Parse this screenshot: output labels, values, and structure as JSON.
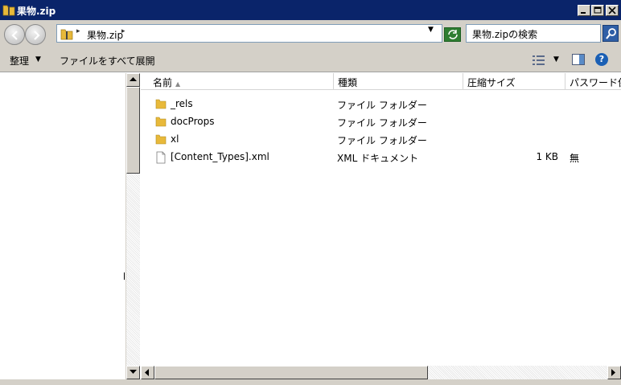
{
  "window": {
    "title": "果物.zip",
    "minimize_icon": "minimize-icon",
    "maximize_icon": "maximize-icon",
    "close_icon": "close-icon"
  },
  "address_bar": {
    "crumb": "果物.zip",
    "search_placeholder": "果物.zipの検索"
  },
  "toolbar": {
    "organize": "整理",
    "open_all": "ファイルをすべて展開"
  },
  "columns": {
    "name": "名前",
    "type": "種類",
    "compressed_size": "圧縮サイズ",
    "password": "パスワード保"
  },
  "files": [
    {
      "name": "_rels",
      "type": "ファイル フォルダー",
      "size": "",
      "password": "",
      "icon": "folder-icon"
    },
    {
      "name": "docProps",
      "type": "ファイル フォルダー",
      "size": "",
      "password": "",
      "icon": "folder-icon"
    },
    {
      "name": "xl",
      "type": "ファイル フォルダー",
      "size": "",
      "password": "",
      "icon": "folder-icon"
    },
    {
      "name": "[Content_Types].xml",
      "type": "XML ドキュメント",
      "size": "1 KB",
      "password": "無",
      "icon": "file-icon"
    }
  ],
  "colors": {
    "titlebar": "#0a246a",
    "chrome": "#d4d0c8",
    "folder": "#e8b93a"
  }
}
